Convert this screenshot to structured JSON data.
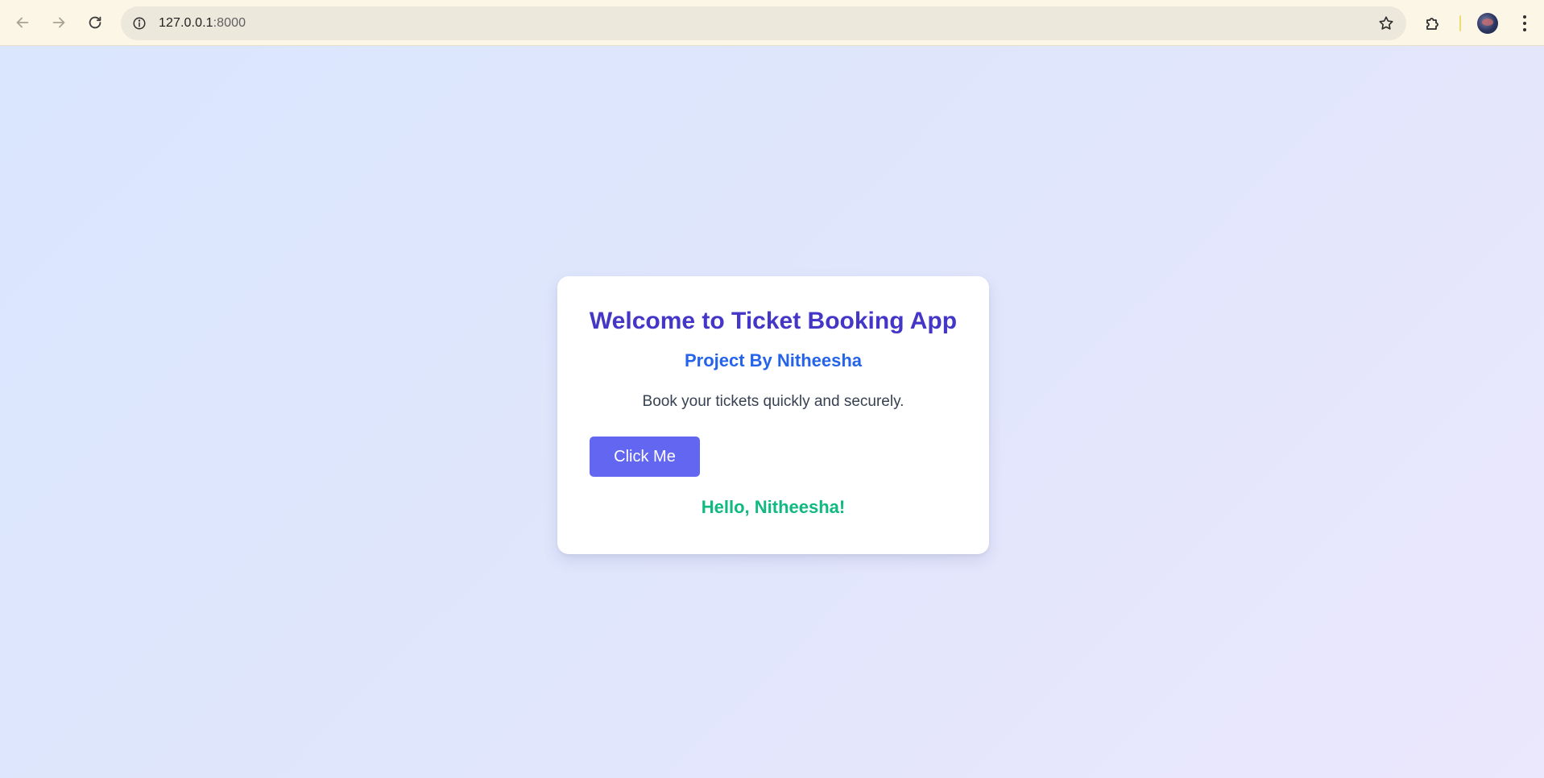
{
  "browser": {
    "url_host": "127.0.0.1",
    "url_port": ":8000",
    "toolbar_bg": "#fcf6e6",
    "omnibox_bg": "#ede8dc"
  },
  "icons": {
    "back": "arrow-left-icon",
    "forward": "arrow-right-icon",
    "reload": "reload-icon",
    "site_info": "info-icon",
    "bookmark": "star-icon",
    "extensions": "puzzle-icon",
    "profile": "avatar",
    "menu": "kebab-menu-icon"
  },
  "page": {
    "title": "Welcome to Ticket Booking App",
    "subtitle": "Project By Nitheesha",
    "description": "Book your tickets quickly and securely.",
    "button_label": "Click Me",
    "greeting": "Hello, Nitheesha!"
  },
  "colors": {
    "title": "#4436c6",
    "subtitle": "#2563eb",
    "description": "#374151",
    "button_bg": "#6366f1",
    "button_text": "#ffffff",
    "greeting": "#10b981",
    "card_bg": "#ffffff",
    "page_gradient_start": "#dae6fe",
    "page_gradient_end": "#ebe7fd"
  }
}
